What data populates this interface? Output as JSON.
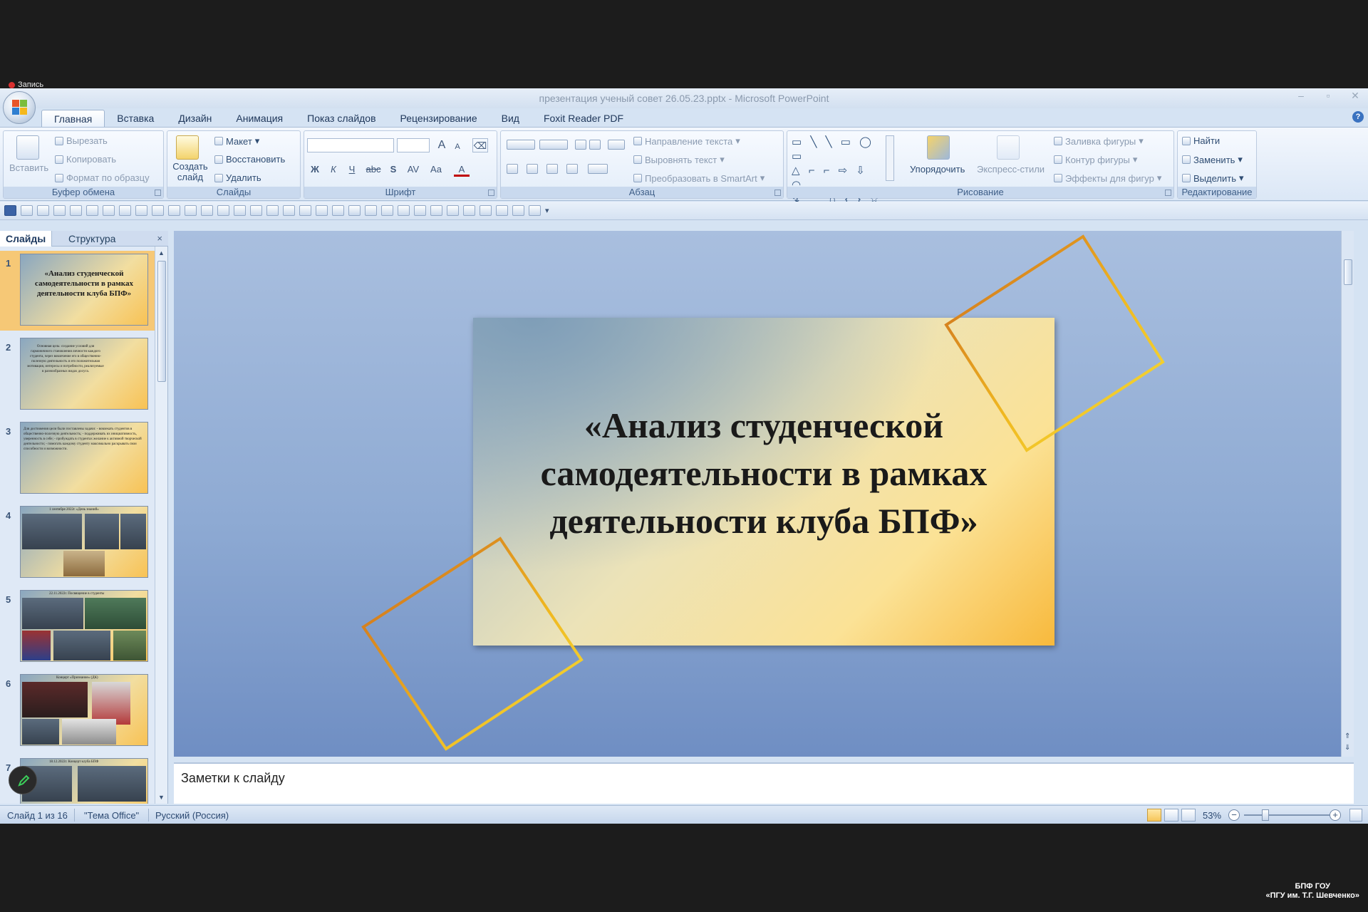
{
  "recording": {
    "label": "Запись"
  },
  "window": {
    "title": "презентация ученый совет 26.05.23.pptx - Microsoft PowerPoint",
    "buttons": [
      "–",
      "▫",
      "✕"
    ]
  },
  "tabs": [
    "Главная",
    "Вставка",
    "Дизайн",
    "Анимация",
    "Показ слайдов",
    "Рецензирование",
    "Вид",
    "Foxit Reader PDF"
  ],
  "ribbon": {
    "clipboard": {
      "label": "Буфер обмена",
      "paste": "Вставить",
      "cut": "Вырезать",
      "copy": "Копировать",
      "format_painter": "Формат по образцу"
    },
    "slides": {
      "label": "Слайды",
      "new_slide": "Создать слайд",
      "layout": "Макет",
      "reset": "Восстановить",
      "delete": "Удалить"
    },
    "font": {
      "label": "Шрифт",
      "bold": "Ж",
      "italic": "К",
      "underline": "Ч",
      "strike": "abc",
      "shadow": "S",
      "spacing": "AV",
      "case": "Aa",
      "color": "A",
      "grow": "A",
      "shrink": "A"
    },
    "paragraph": {
      "label": "Абзац",
      "text_direction": "Направление текста",
      "align_text": "Выровнять текст",
      "smartart": "Преобразовать в SmartArt"
    },
    "drawing": {
      "label": "Рисование",
      "arrange": "Упорядочить",
      "quick_styles": "Экспресс-стили",
      "shape_fill": "Заливка фигуры",
      "shape_outline": "Контур фигуры",
      "shape_effects": "Эффекты для фигур",
      "shapes_row1": "▭ ╲ ╲ ▭ ◯ ▭",
      "shapes_row2": "△ ⌐ ⌐ ⇨ ⇩ ◠",
      "shapes_row3": "↯ ⌒ ∩ { } ☆"
    },
    "editing": {
      "label": "Редактирование",
      "find": "Найти",
      "replace": "Заменить",
      "select": "Выделить"
    }
  },
  "left_panel": {
    "tab_slides": "Слайды",
    "tab_outline": "Структура",
    "close": "×",
    "thumbnails": [
      {
        "num": "1",
        "title": "«Анализ студенческой самодеятельности в рамках деятельности клуба БПФ»"
      },
      {
        "num": "2",
        "text": "Основная цель: создание условий для гармоничного становления личности каждого студента, через вовлечение его в общественно-полезную деятельность и его положительная мотивация, интересы и потребности, реализуемые в разнообразных видах досуга."
      },
      {
        "num": "3",
        "text": "Для достижения цели были поставлены задачи: - вовлекать студентов в общественно-полезную деятельность; - поддерживать их инициативность, уверенность в себе; - пробуждать в студентах желание к активной творческой деятельности; - помогать каждому студенту максимально раскрывать свои способности и возможности."
      },
      {
        "num": "4",
        "caption": "1 сентября 2022г. «День знаний»"
      },
      {
        "num": "5",
        "caption": "22.11.2022г. Посвящение в студенты"
      },
      {
        "num": "6",
        "caption": "Концерт «Признание» (ДК)"
      },
      {
        "num": "7",
        "caption": "18.12.2022г. Концерт клуба БПФ"
      }
    ]
  },
  "slide": {
    "title": "«Анализ студенческой самодеятельности в рамках деятельности клуба БПФ»"
  },
  "notes": {
    "placeholder": "Заметки к слайду"
  },
  "status": {
    "slide_of": "Слайд 1 из 16",
    "theme": "\"Тема Office\"",
    "language": "Русский (Россия)",
    "zoom": "53%"
  },
  "watermark": {
    "line1": "БПФ ГОУ",
    "line2": "«ПГУ им. Т.Г. Шевченко»"
  },
  "colors": {
    "accent_selected": "#f6c876",
    "deco_orange": "#c8641e",
    "deco_yellow": "#f5e23a"
  }
}
